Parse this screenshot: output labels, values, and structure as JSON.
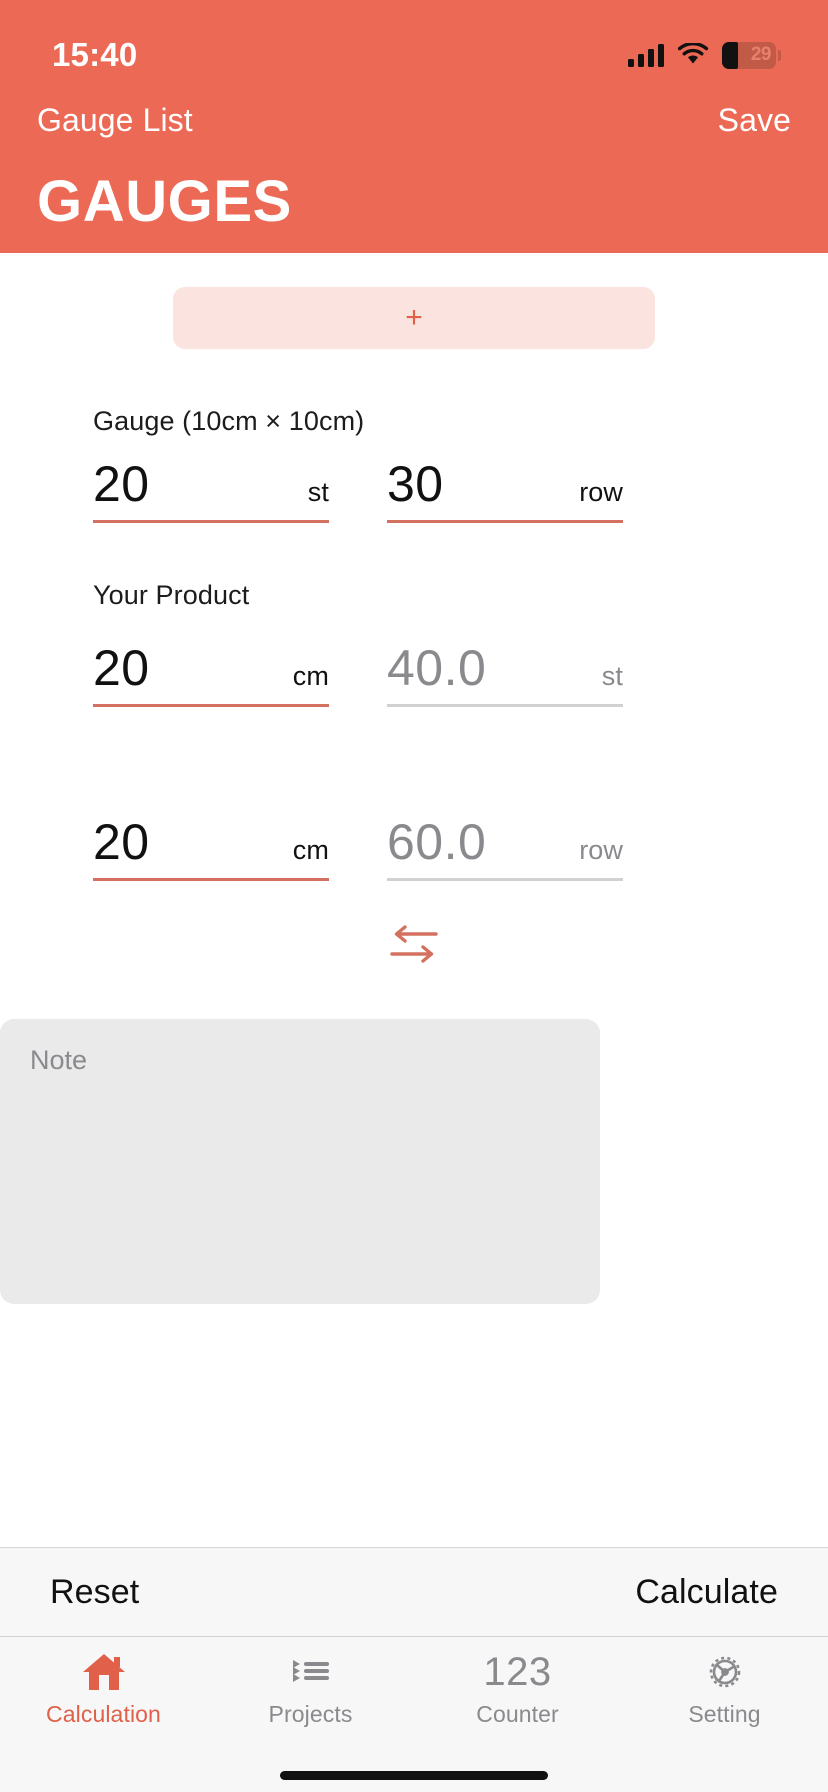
{
  "status_bar": {
    "time": "15:40",
    "cellular_icon": "cellular-bars-icon",
    "wifi_icon": "wifi-icon",
    "battery_percent": "29",
    "battery_icon": "battery-low-power-icon"
  },
  "nav": {
    "back_label": "Gauge List",
    "save_label": "Save",
    "title": "GAUGES"
  },
  "add_button": {
    "label": "+",
    "icon": "plus-icon"
  },
  "gauge_section": {
    "label": "Gauge (10cm × 10cm)",
    "stitches": {
      "value": "20",
      "unit": "st"
    },
    "rows": {
      "value": "30",
      "unit": "row"
    }
  },
  "product_section": {
    "label": "Your Product",
    "row1": {
      "input": {
        "value": "20",
        "unit": "cm"
      },
      "result": {
        "value": "40.0",
        "unit": "st"
      }
    },
    "row2": {
      "input": {
        "value": "20",
        "unit": "cm"
      },
      "result": {
        "value": "60.0",
        "unit": "row"
      }
    },
    "swap_icon": "swap-arrows-icon"
  },
  "note": {
    "placeholder": "Note",
    "value": ""
  },
  "toolbar": {
    "reset_label": "Reset",
    "calculate_label": "Calculate"
  },
  "tab_bar": {
    "tabs": [
      {
        "label": "Calculation",
        "icon": "home-icon",
        "active": true
      },
      {
        "label": "Projects",
        "icon": "list-icon",
        "active": false
      },
      {
        "label": "Counter",
        "icon": "123-icon",
        "glyph": "123",
        "active": false
      },
      {
        "label": "Setting",
        "icon": "gear-icon",
        "active": false
      }
    ]
  },
  "colors": {
    "accent": "#ec6a55",
    "accent_text": "#e0604a",
    "accent_soft": "#fbe3df",
    "underline_active": "#d4705f",
    "underline_disabled": "#d1d1d1",
    "muted_text": "#8a8a8e",
    "note_background": "#eaeaea",
    "bar_background": "#f7f7f7"
  }
}
